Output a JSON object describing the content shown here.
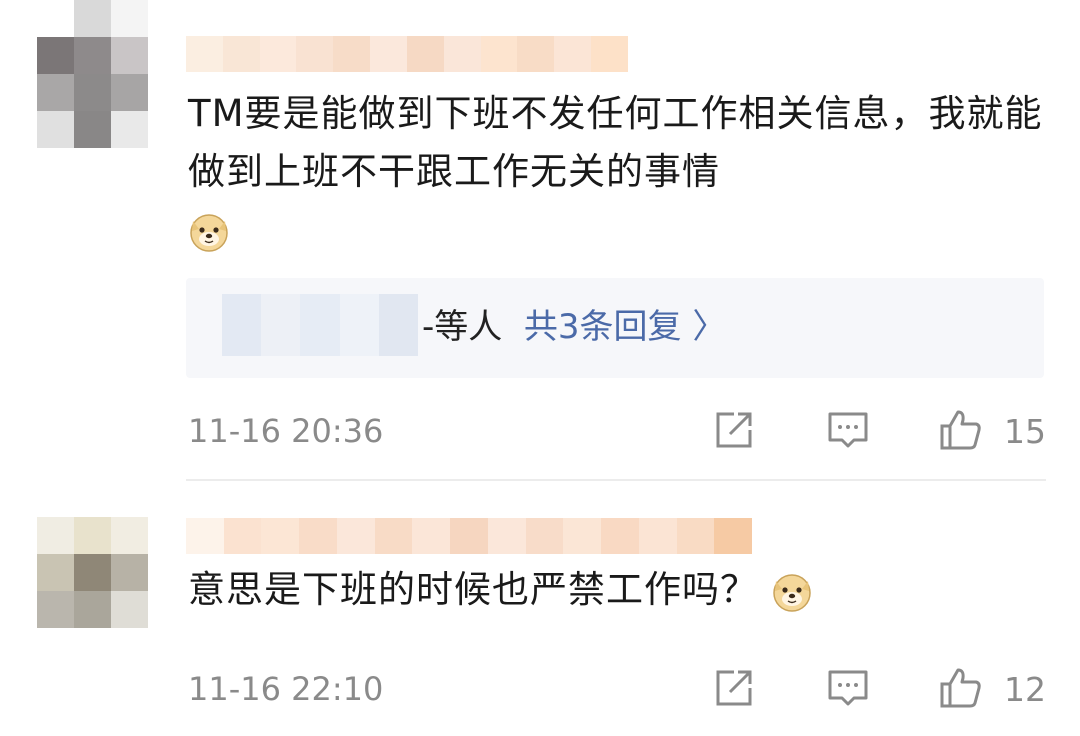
{
  "comments": [
    {
      "text": "TM要是能做到下班不发任何工作相关信息，我就能做到上班不干跟工作无关的事情",
      "reply_suffix": "-等人",
      "reply_link": "共3条回复 〉",
      "time": "11-16 20:36",
      "likes": "15",
      "emoji": "doge-emoji"
    },
    {
      "text": "意思是下班的时候也严禁工作吗？",
      "time": "11-16 22:10",
      "likes": "12",
      "emoji": "doge-emoji"
    }
  ],
  "icons": {
    "share": "share-icon",
    "comment": "comment-icon",
    "like": "thumbs-up-icon"
  },
  "colors": {
    "link": "#4b6aa8",
    "meta_text": "#8a8a8a",
    "reply_bg": "#f6f7fa"
  }
}
